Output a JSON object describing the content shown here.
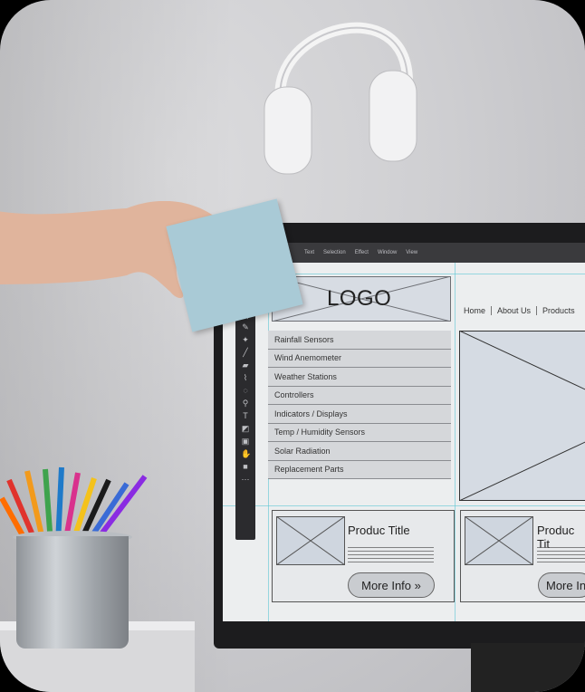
{
  "wireframe": {
    "logo": "LOGO",
    "nav": [
      "Home",
      "About Us",
      "Products"
    ],
    "menu": [
      "Rainfall Sensors",
      "Wind Anemometer",
      "Weather Stations",
      "Controllers",
      "Indicators / Displays",
      "Temp / Humidity Sensors",
      "Solar Radiation",
      "Replacement Parts"
    ],
    "cards": [
      {
        "title": "Produc Title",
        "button": "More Info »"
      },
      {
        "title": "Produc Tit",
        "button": "More In"
      }
    ]
  },
  "app_menu": [
    "Text",
    "Selection",
    "Effect",
    "Window",
    "View"
  ],
  "colors": {
    "sticky_note": "#a9cad6",
    "screen_bg": "#eceeef",
    "guide": "#5ec6d4"
  }
}
